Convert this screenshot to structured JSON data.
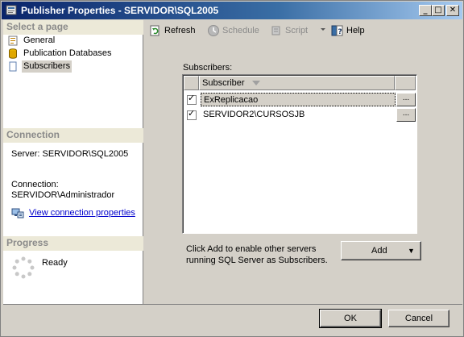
{
  "window": {
    "title": "Publisher Properties - SERVIDOR\\SQL2005",
    "minimize_label": "_",
    "maximize_label": "□",
    "close_label": "✕"
  },
  "left": {
    "select_page_header": "Select a page",
    "pages": [
      {
        "label": "General",
        "icon": "properties-icon"
      },
      {
        "label": "Publication Databases",
        "icon": "database-icon"
      },
      {
        "label": "Subscribers",
        "icon": "page-icon",
        "selected": true
      }
    ],
    "connection_header": "Connection",
    "server_line": "Server: SERVIDOR\\SQL2005",
    "connection_label": "Connection:",
    "connection_value": "SERVIDOR\\Administrador",
    "view_link": "View connection properties",
    "progress_header": "Progress",
    "progress_status": "Ready"
  },
  "toolbar": {
    "refresh": "Refresh",
    "schedule": "Schedule",
    "script": "Script",
    "help": "Help"
  },
  "subscribers": {
    "label": "Subscribers:",
    "column_header": "Subscriber",
    "rows": [
      {
        "name": "ExReplicacao",
        "checked": true,
        "selected": true,
        "ellipsis": "..."
      },
      {
        "name": "SERVIDOR2\\CURSOSJB",
        "checked": true,
        "selected": false,
        "ellipsis": "..."
      }
    ],
    "hint": "Click Add to enable other servers running SQL Server as Subscribers.",
    "add_label": "Add",
    "add_arrow": "▼"
  },
  "footer": {
    "ok_label": "OK",
    "cancel_label": "Cancel"
  },
  "colors": {
    "title_start": "#0a246a",
    "title_end": "#a6caf0",
    "face": "#d4d0c8",
    "link": "#0000cc"
  }
}
